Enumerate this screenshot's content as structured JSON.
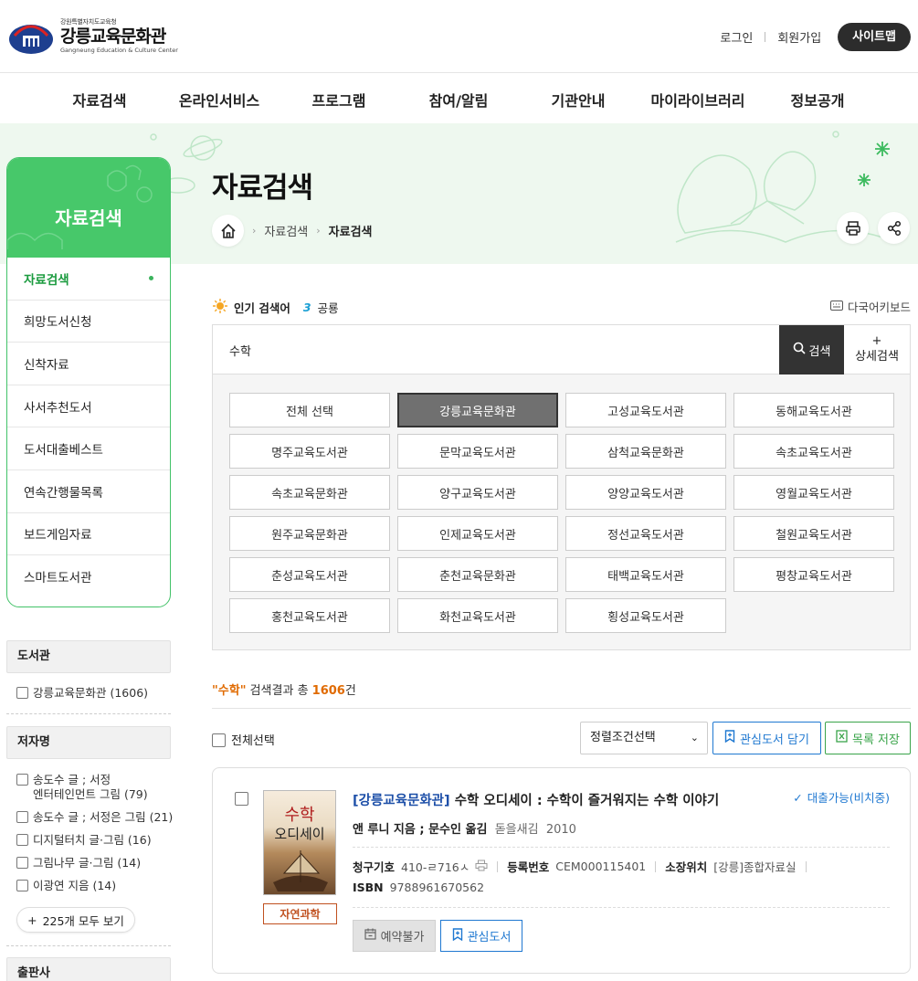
{
  "header": {
    "logo_sub": "강원특별자치도교육청",
    "logo_main": "강릉교육문화관",
    "logo_en": "Gangneung Education & Culture Center",
    "login": "로그인",
    "join": "회원가입",
    "sitemap": "사이트맵"
  },
  "gnb": [
    "자료검색",
    "온라인서비스",
    "프로그램",
    "참여/알림",
    "기관안내",
    "마이라이브러리",
    "정보공개"
  ],
  "banner": {
    "title": "자료검색",
    "crumb1": "자료검색",
    "crumb2": "자료검색"
  },
  "sidebar": {
    "title": "자료검색",
    "items": [
      "자료검색",
      "희망도서신청",
      "신착자료",
      "사서추천도서",
      "도서대출베스트",
      "연속간행물목록",
      "보드게임자료",
      "스마트도서관"
    ]
  },
  "facets": {
    "library_title": "도서관",
    "library_items": [
      "강릉교육문화관 (1606)"
    ],
    "author_title": "저자명",
    "author_items": [
      "송도수 글 ; 서정",
      "엔터테인먼트 그림 (79)",
      "송도수 글 ; 서정은 그림 (21)",
      "디지털터치 글·그림 (16)",
      "그림나무 글·그림 (14)",
      "이광연 지음 (14)"
    ],
    "more": "225개 모두 보기",
    "publisher_title": "출판사"
  },
  "search": {
    "popular_label": "인기 검색어",
    "popular_rank": "3",
    "popular_keyword": "공룡",
    "keyboard": "다국어키보드",
    "query": "수학",
    "search_btn": "검색",
    "adv_plus": "+",
    "adv_label": "상세검색",
    "libraries": [
      "전체 선택",
      "강릉교육문화관",
      "고성교육도서관",
      "동해교육도서관",
      "명주교육도서관",
      "문막교육도서관",
      "삼척교육문화관",
      "속초교육도서관",
      "속초교육문화관",
      "양구교육도서관",
      "양양교육도서관",
      "영월교육도서관",
      "원주교육문화관",
      "인제교육도서관",
      "정선교육도서관",
      "철원교육도서관",
      "춘성교육도서관",
      "춘천교육문화관",
      "태백교육도서관",
      "평창교육도서관",
      "홍천교육도서관",
      "화천교육도서관",
      "횡성교육도서관"
    ],
    "selected_library": "강릉교육문화관"
  },
  "results": {
    "query_quoted": "\"수학\"",
    "summary_mid": " 검색결과 총 ",
    "count": "1606",
    "unit": "건",
    "select_all": "전체선택",
    "sort": "정렬조건선택",
    "fav_all": "관심도서 담기",
    "save_list": "목록 저장"
  },
  "book": {
    "library": "[강릉교육문화관]",
    "title": " 수학 오디세이 : 수학이 즐거워지는 수학 이야기",
    "availability": "대출가능(비치중)",
    "author": "앤 루니 지음 ; 문수인 옮김",
    "publisher": "돋을새김",
    "year": "2010",
    "call_label": "청구기호",
    "call_no": "410-ㄹ716ㅅ",
    "reg_label": "등록번호",
    "reg_no": "CEM000115401",
    "loc_label": "소장위치",
    "location": "[강릉]종합자료실",
    "isbn_label": "ISBN",
    "isbn": "9788961670562",
    "category": "자연과학",
    "cover_t1": "수학",
    "cover_t2": "오디세이",
    "reserve": "예약불가",
    "favorite": "관심도서"
  },
  "colors": {
    "brand_green": "#47c86a",
    "accent_orange": "#e06a00",
    "link_blue": "#1f78d1",
    "save_green": "#3aa44a"
  }
}
